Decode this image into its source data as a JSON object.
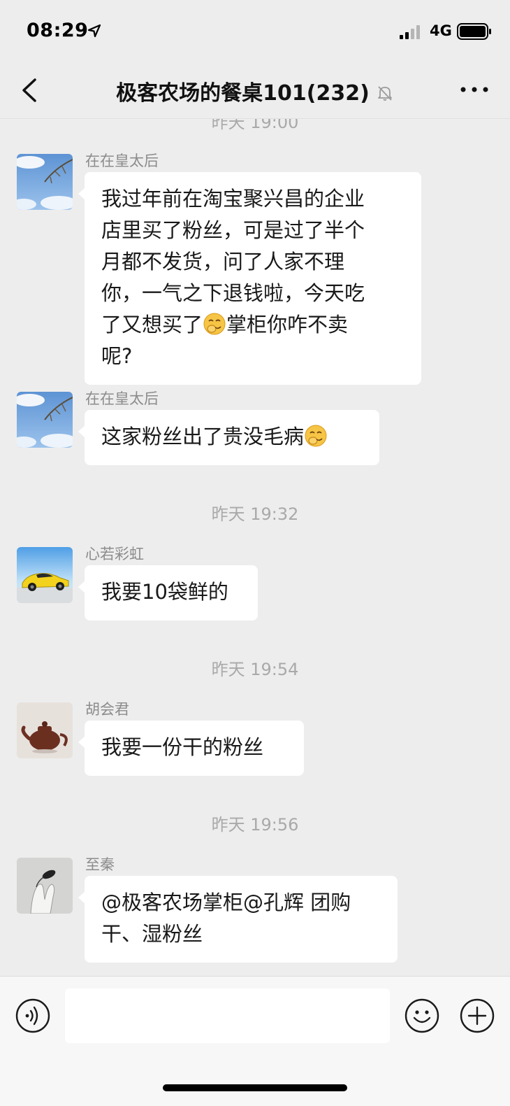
{
  "status_bar": {
    "time": "08:29",
    "network": "4G"
  },
  "nav": {
    "title": "极客农场的餐桌101(232)"
  },
  "partial_time": "昨天 19:00",
  "messages": [
    {
      "sender": "在在皇太后",
      "lines": [
        "我过年前在淘宝聚兴昌的企业",
        "店里买了粉丝，可是过了半个",
        "月都不发货，问了人家不理",
        "你，一气之下退钱啦，今天吃",
        "了又想买了",
        "掌柜你咋不卖",
        "呢?"
      ],
      "avatar": "sky-avatar"
    },
    {
      "sender": "在在皇太后",
      "text": "这家粉丝出了贵没毛病",
      "avatar": "sky-avatar"
    },
    {
      "time": "昨天 19:32"
    },
    {
      "sender": "心若彩虹",
      "text": "我要10袋鲜的",
      "avatar": "car-avatar"
    },
    {
      "time": "昨天 19:54"
    },
    {
      "sender": "胡会君",
      "text": "我要一份干的粉丝",
      "avatar": "teapot-avatar"
    },
    {
      "time": "昨天 19:56"
    },
    {
      "sender": "至秦",
      "lines": [
        "@极客农场掌柜@孔辉 团购",
        "干、湿粉丝"
      ],
      "avatar": "ink-avatar"
    }
  ],
  "input": {
    "placeholder": ""
  },
  "colors": {
    "background": "#ededed",
    "bubble": "#ffffff",
    "timestamp": "#a9a9a9",
    "sender_name": "#8c8c8c"
  }
}
